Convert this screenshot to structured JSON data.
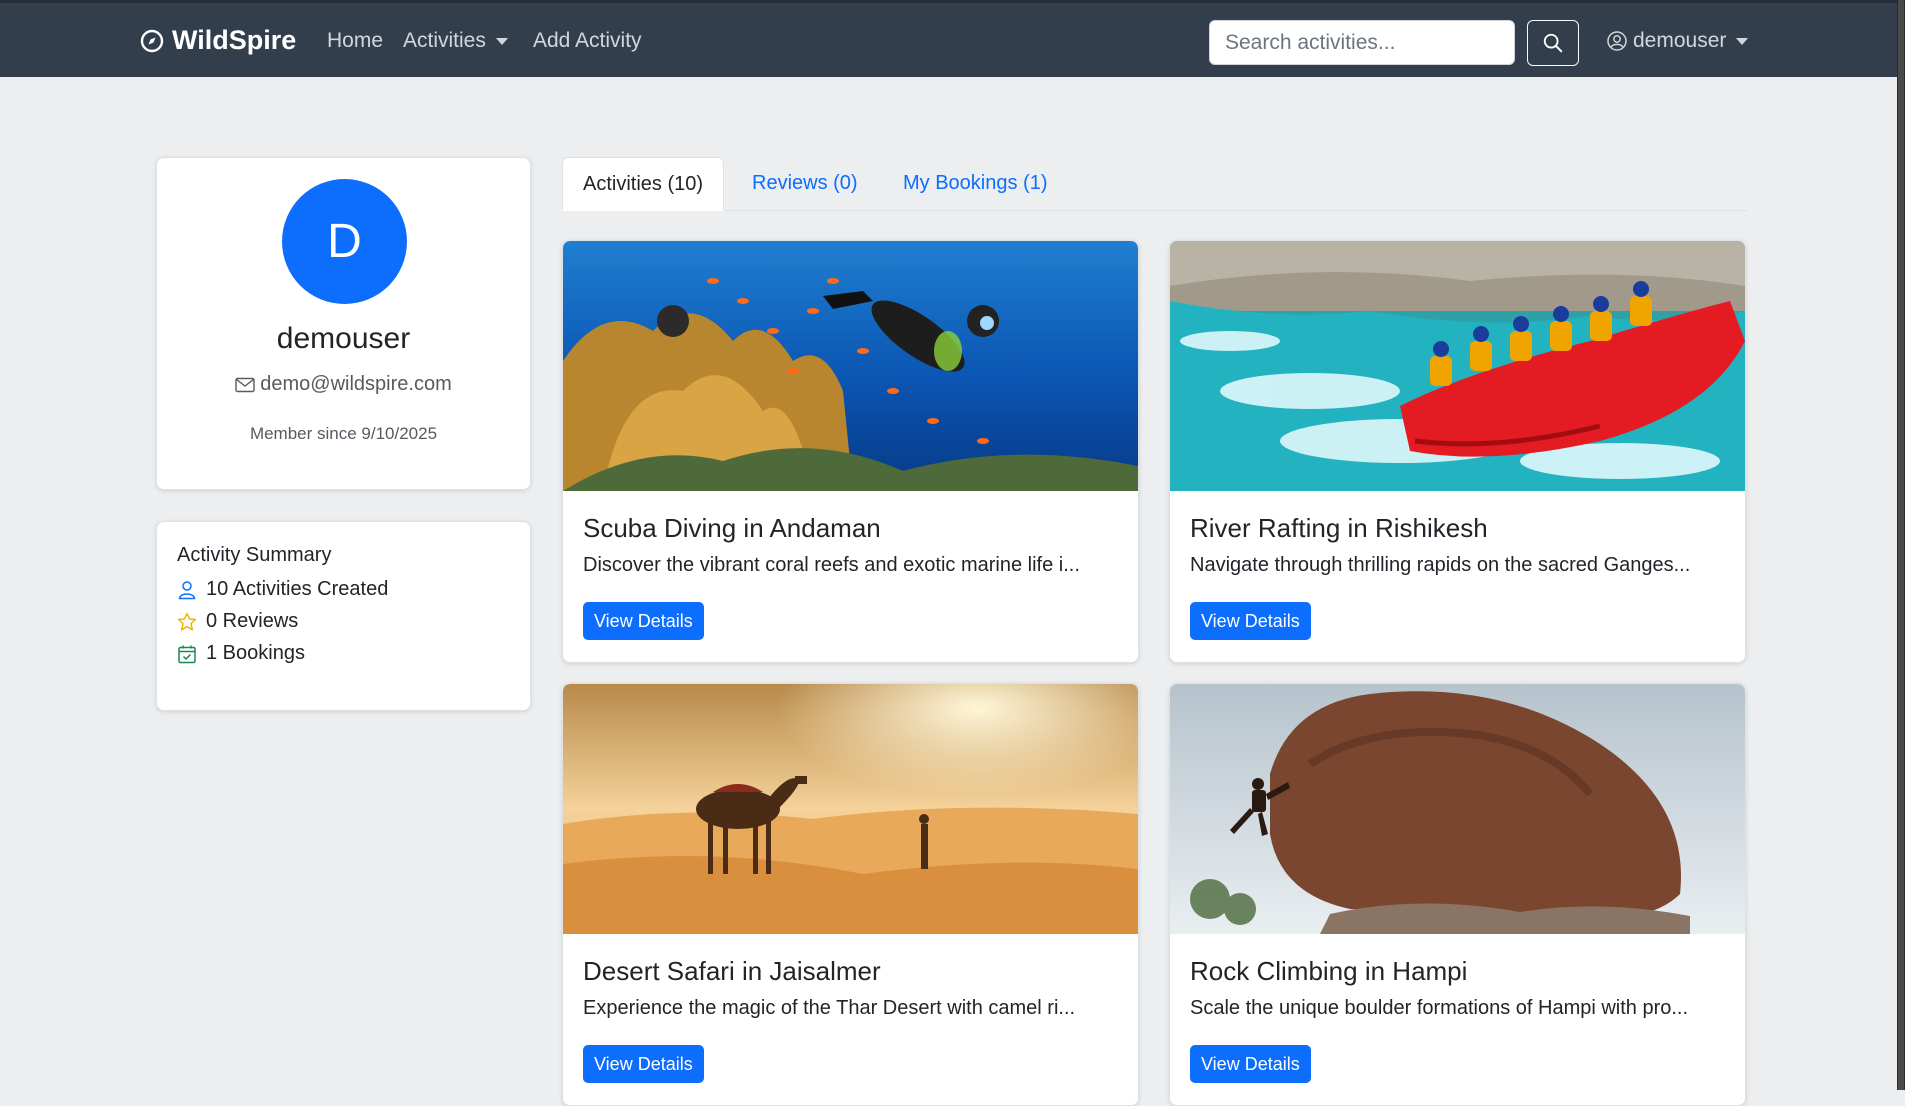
{
  "navbar": {
    "brand": "WildSpire",
    "links": [
      "Home",
      "Activities",
      "Add Activity"
    ],
    "search_placeholder": "Search activities...",
    "user": "demouser"
  },
  "profile": {
    "initial": "D",
    "username": "demouser",
    "email": "demo@wildspire.com",
    "member_since": "Member since 9/10/2025"
  },
  "summary": {
    "title": "Activity Summary",
    "items": [
      "10 Activities Created",
      "0 Reviews",
      "1 Bookings"
    ]
  },
  "tabs": [
    "Activities (10)",
    "Reviews (0)",
    "My Bookings (1)"
  ],
  "activities": [
    {
      "title": "Scuba Diving in Andaman",
      "desc": "Discover the vibrant coral reefs and exotic marine life i...",
      "button": "View Details"
    },
    {
      "title": "River Rafting in Rishikesh",
      "desc": "Navigate through thrilling rapids on the sacred Ganges...",
      "button": "View Details"
    },
    {
      "title": "Desert Safari in Jaisalmer",
      "desc": "Experience the magic of the Thar Desert with camel ri...",
      "button": "View Details"
    },
    {
      "title": "Rock Climbing in Hampi",
      "desc": "Scale the unique boulder formations of Hampi with pro...",
      "button": "View Details"
    }
  ],
  "colors": {
    "primary": "#0d6efd",
    "navbar": "#333e4c",
    "background": "#eceeef"
  }
}
